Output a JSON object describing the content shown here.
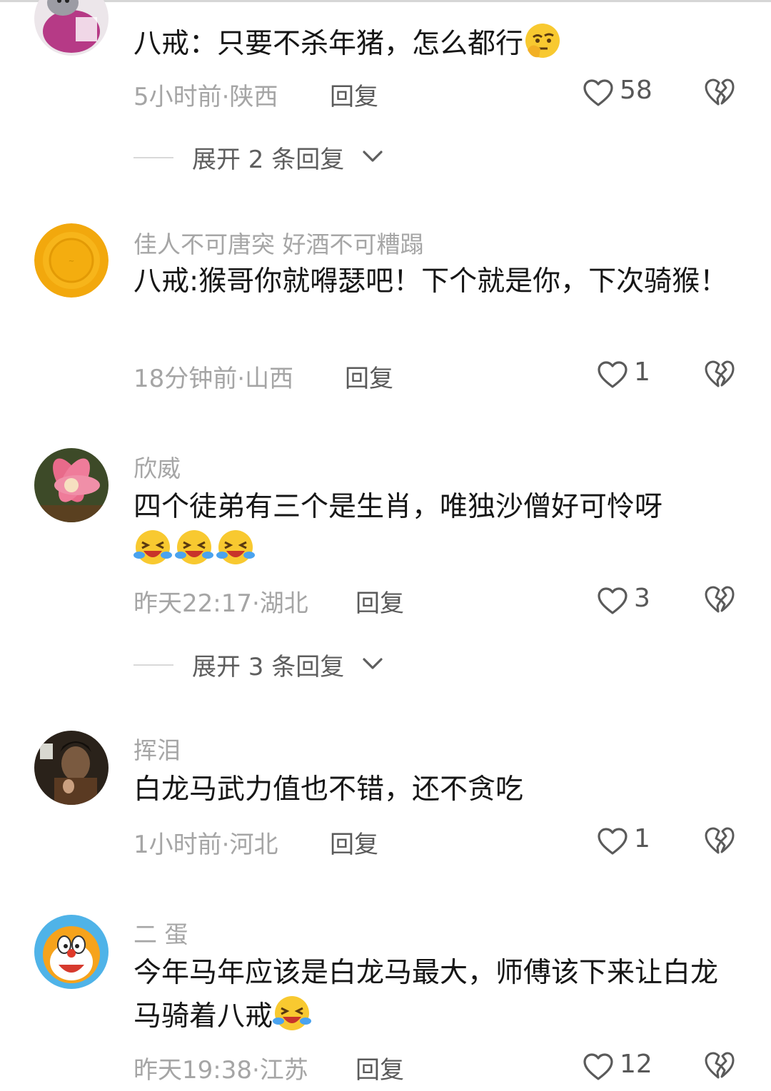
{
  "comments": [
    {
      "username": "",
      "text": "八戒：只要不杀年猪，怎么都行",
      "emoji": "thinking-emoji",
      "time_location": "5小时前·陕西",
      "reply_label": "回复",
      "likes": "58",
      "expand_label": "展开 2 条回复"
    },
    {
      "username": "佳人不可唐突 好酒不可糟蹋",
      "text": "八戒:猴哥你就嘚瑟吧！下个就是你，下次骑猴！",
      "time_location": "18分钟前·山西",
      "reply_label": "回复",
      "likes": "1"
    },
    {
      "username": "欣威",
      "text": "四个徒弟有三个是生肖，唯独沙僧好可怜呀",
      "emoji": "crying-laughing-emoji",
      "time_location": "昨天22:17·湖北",
      "reply_label": "回复",
      "likes": "3",
      "expand_label": "展开 3 条回复"
    },
    {
      "username": "挥泪",
      "text": "白龙马武力值也不错，还不贪吃",
      "time_location": "1小时前·河北",
      "reply_label": "回复",
      "likes": "1"
    },
    {
      "username": "二 蛋",
      "text": "今年马年应该是白龙马最大，师傅该下来让白龙马骑着八戒",
      "emoji": "crying-laughing-emoji",
      "time_location": "昨天19:38·江苏",
      "reply_label": "回复",
      "likes": "12"
    }
  ],
  "icons": {
    "like": "heart-outline-icon",
    "dislike": "broken-heart-icon",
    "expand": "chevron-down-icon"
  },
  "colors": {
    "text": "#161616",
    "muted": "#a5a5a5",
    "action": "#5a5a5a"
  }
}
